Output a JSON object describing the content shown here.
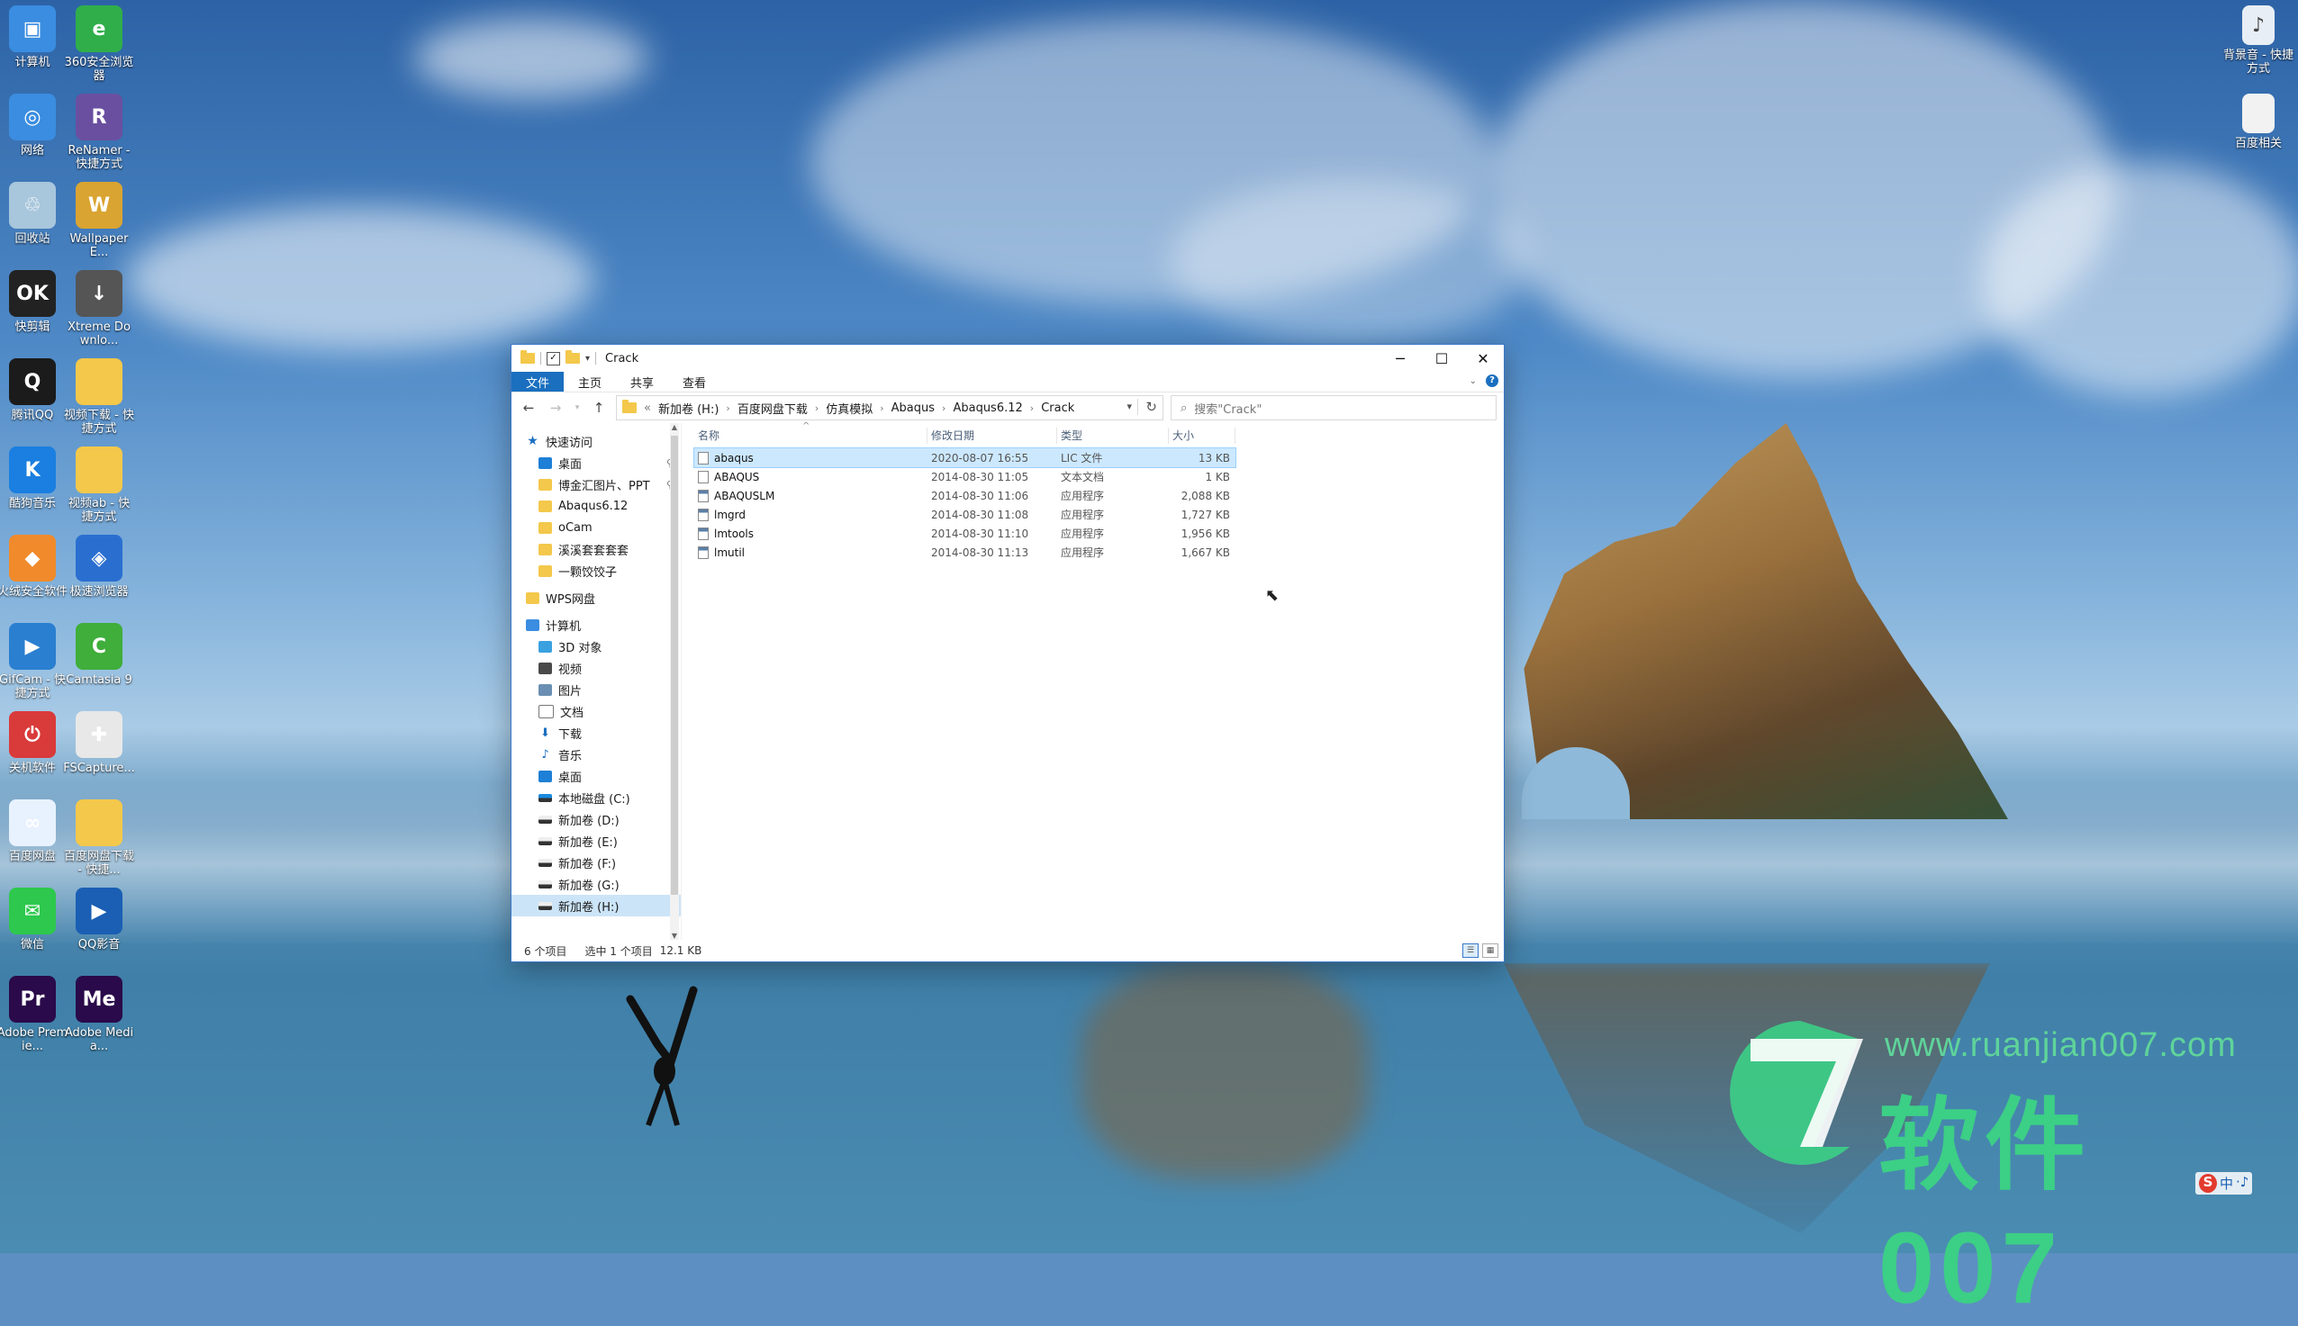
{
  "desktop": {
    "icons_left": [
      {
        "label": "计算机",
        "color": "#3a8de0",
        "glyph": "▣",
        "name": "computer-icon"
      },
      {
        "label": "360安全浏览器",
        "color": "#2fae4a",
        "glyph": "e",
        "name": "browser-360-icon"
      },
      {
        "label": "网络",
        "color": "#3a8de0",
        "glyph": "◎",
        "name": "network-icon"
      },
      {
        "label": "ReNamer - 快捷方式",
        "color": "#6a4fa0",
        "glyph": "R",
        "name": "renamer-icon"
      },
      {
        "label": "回收站",
        "color": "#a8c6dc",
        "glyph": "♲",
        "name": "recycle-bin-icon"
      },
      {
        "label": "Wallpaper E...",
        "color": "#d9a431",
        "glyph": "W",
        "name": "wallpaper-engine-icon"
      },
      {
        "label": "快剪辑",
        "color": "#222222",
        "glyph": "OK",
        "name": "kuaijianji-icon"
      },
      {
        "label": "Xtreme Downlo...",
        "color": "#555555",
        "glyph": "↓",
        "name": "xtreme-download-icon"
      },
      {
        "label": "腾讯QQ",
        "color": "#1b1b1b",
        "glyph": "Q",
        "name": "qq-icon"
      },
      {
        "label": "视频下载 - 快捷方式",
        "color": "#f3c84b",
        "glyph": "",
        "name": "video-download-folder-icon"
      },
      {
        "label": "酷狗音乐",
        "color": "#1a7fe0",
        "glyph": "K",
        "name": "kugou-icon"
      },
      {
        "label": "视频ab - 快捷方式",
        "color": "#f3c84b",
        "glyph": "",
        "name": "video-ab-folder-icon"
      },
      {
        "label": "火绒安全软件",
        "color": "#f08a2a",
        "glyph": "◆",
        "name": "huorong-icon"
      },
      {
        "label": "极速浏览器",
        "color": "#2a6fd0",
        "glyph": "◈",
        "name": "speed-browser-icon"
      },
      {
        "label": "GifCam - 快捷方式",
        "color": "#2a7fd0",
        "glyph": "▶",
        "name": "gifcam-icon"
      },
      {
        "label": "Camtasia 9",
        "color": "#3fae3a",
        "glyph": "C",
        "name": "camtasia-icon"
      },
      {
        "label": "关机软件",
        "color": "#d93a3a",
        "glyph": "⏻",
        "name": "shutdown-app-icon"
      },
      {
        "label": "FSCapture...",
        "color": "#e8e8e8",
        "glyph": "✚",
        "name": "fscapture-icon"
      },
      {
        "label": "百度网盘",
        "color": "#e8f2ff",
        "glyph": "∞",
        "name": "baidu-netdisk-icon"
      },
      {
        "label": "百度网盘下载 - 快捷...",
        "color": "#f3c84b",
        "glyph": "",
        "name": "baidu-download-folder-icon"
      },
      {
        "label": "微信",
        "color": "#2dc84d",
        "glyph": "✉",
        "name": "wechat-icon"
      },
      {
        "label": "QQ影音",
        "color": "#1a5fb4",
        "glyph": "▶",
        "name": "qq-player-icon"
      },
      {
        "label": "Adobe Premie...",
        "color": "#2a0a4a",
        "glyph": "Pr",
        "name": "premiere-icon"
      },
      {
        "label": "Adobe Media...",
        "color": "#2a0a4a",
        "glyph": "Me",
        "name": "media-encoder-icon"
      }
    ],
    "icons_right": [
      {
        "label": "背景音 - 快捷方式",
        "color": "#e8eef5",
        "glyph": "♪",
        "name": "background-music-icon"
      },
      {
        "label": "百度相关",
        "color": "#f2f2f2",
        "glyph": "",
        "name": "baidu-related-icon"
      }
    ]
  },
  "window": {
    "title": "Crack",
    "ribbon_tabs": [
      "文件",
      "主页",
      "共享",
      "查看"
    ],
    "breadcrumb": [
      "«",
      "新加卷 (H:)",
      "百度网盘下载",
      "仿真模拟",
      "Abaqus",
      "Abaqus6.12",
      "Crack"
    ],
    "search_placeholder": "搜索\"Crack\"",
    "nav": [
      {
        "label": "快速访问",
        "icon": "star",
        "level": 0,
        "pin": false
      },
      {
        "label": "桌面",
        "icon": "desk",
        "level": 1,
        "pin": true
      },
      {
        "label": "博金汇图片、PPT",
        "icon": "fold",
        "level": 1,
        "pin": true
      },
      {
        "label": "Abaqus6.12",
        "icon": "fold",
        "level": 1,
        "pin": false
      },
      {
        "label": "oCam",
        "icon": "fold",
        "level": 1,
        "pin": false
      },
      {
        "label": "溪溪套套套套",
        "icon": "fold",
        "level": 1,
        "pin": false
      },
      {
        "label": "一颗饺饺子",
        "icon": "fold",
        "level": 1,
        "pin": false
      },
      {
        "label": "",
        "icon": "",
        "level": 0,
        "pin": false
      },
      {
        "label": "WPS网盘",
        "icon": "fold",
        "level": 0,
        "pin": false
      },
      {
        "label": "",
        "icon": "",
        "level": 0,
        "pin": false
      },
      {
        "label": "计算机",
        "icon": "pc",
        "level": 0,
        "pin": false
      },
      {
        "label": "3D 对象",
        "icon": "obj",
        "level": 1,
        "pin": false
      },
      {
        "label": "视频",
        "icon": "video",
        "level": 1,
        "pin": false
      },
      {
        "label": "图片",
        "icon": "pic",
        "level": 1,
        "pin": false
      },
      {
        "label": "文档",
        "icon": "doc",
        "level": 1,
        "pin": false
      },
      {
        "label": "下载",
        "icon": "down",
        "level": 1,
        "pin": false
      },
      {
        "label": "音乐",
        "icon": "music",
        "level": 1,
        "pin": false
      },
      {
        "label": "桌面",
        "icon": "desk",
        "level": 1,
        "pin": false
      },
      {
        "label": "本地磁盘 (C:)",
        "icon": "diskc",
        "level": 1,
        "pin": false
      },
      {
        "label": "新加卷 (D:)",
        "icon": "disk",
        "level": 1,
        "pin": false
      },
      {
        "label": "新加卷 (E:)",
        "icon": "disk",
        "level": 1,
        "pin": false
      },
      {
        "label": "新加卷 (F:)",
        "icon": "disk",
        "level": 1,
        "pin": false
      },
      {
        "label": "新加卷 (G:)",
        "icon": "disk",
        "level": 1,
        "pin": false
      },
      {
        "label": "新加卷 (H:)",
        "icon": "disk",
        "level": 1,
        "pin": false,
        "selected": true
      }
    ],
    "columns": {
      "name": "名称",
      "date": "修改日期",
      "type": "类型",
      "size": "大小"
    },
    "files": [
      {
        "name": "abaqus",
        "date": "2020-08-07 16:55",
        "type": "LIC 文件",
        "size": "13 KB",
        "icon": "file",
        "selected": true
      },
      {
        "name": "ABAQUS",
        "date": "2014-08-30 11:05",
        "type": "文本文档",
        "size": "1 KB",
        "icon": "file"
      },
      {
        "name": "ABAQUSLM",
        "date": "2014-08-30 11:06",
        "type": "应用程序",
        "size": "2,088 KB",
        "icon": "exe"
      },
      {
        "name": "lmgrd",
        "date": "2014-08-30 11:08",
        "type": "应用程序",
        "size": "1,727 KB",
        "icon": "exe"
      },
      {
        "name": "lmtools",
        "date": "2014-08-30 11:10",
        "type": "应用程序",
        "size": "1,956 KB",
        "icon": "exe"
      },
      {
        "name": "lmutil",
        "date": "2014-08-30 11:13",
        "type": "应用程序",
        "size": "1,667 KB",
        "icon": "exe"
      }
    ],
    "status": {
      "count": "6 个项目",
      "selected": "选中 1 个项目",
      "size": "12.1 KB"
    }
  },
  "watermark": {
    "url": "www.ruanjian007.com",
    "text": "软件 007",
    "color": "#3ccf86"
  },
  "ime": {
    "s": "S",
    "mode": "中",
    "extra": "·♪"
  }
}
